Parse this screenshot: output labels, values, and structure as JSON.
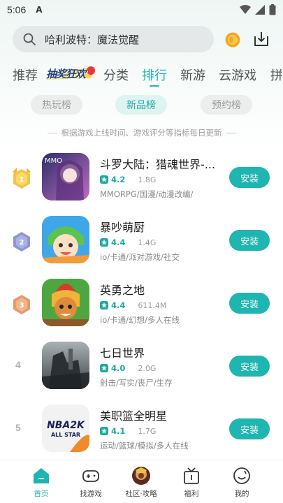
{
  "status_bar": {
    "time": "5:06",
    "indicator": "A"
  },
  "search": {
    "text": "哈利波特：魔法觉醒"
  },
  "tabs": [
    {
      "label": "推荐"
    },
    {
      "label": "抽奖狂欢",
      "is_logo": true
    },
    {
      "label": "分类"
    },
    {
      "label": "排行",
      "active": true
    },
    {
      "label": "新游"
    },
    {
      "label": "云游戏"
    },
    {
      "label": "拼"
    }
  ],
  "chips": [
    {
      "label": "热玩榜"
    },
    {
      "label": "新品榜",
      "active": true
    },
    {
      "label": "预约榜"
    }
  ],
  "subtitle": "根据游戏上线时间、游戏评分等指标每日更新",
  "games": [
    {
      "rank": "1",
      "title": "斗罗大陆：猎魂世界-...",
      "score": "4.2",
      "size": "1.8G",
      "tags": "MMORPG/国漫/动漫改编/",
      "install": "安装",
      "icon_text": "MMO"
    },
    {
      "rank": "2",
      "title": "暴吵萌厨",
      "score": "4.4",
      "size": "1.4G",
      "tags": "io/卡通/派对游戏/社交",
      "install": "安装"
    },
    {
      "rank": "3",
      "title": "英勇之地",
      "score": "4.4",
      "size": "611.4M",
      "tags": "io/卡通/幻想/多人在线",
      "install": "安装"
    },
    {
      "rank": "4",
      "title": "七日世界",
      "score": "4.0",
      "size": "2.0G",
      "tags": "射击/写实/丧尸/生存",
      "install": "安装"
    },
    {
      "rank": "5",
      "title": "美职篮全明星",
      "score": "4.1",
      "size": "1.7G",
      "tags": "运动/篮球/模拟/多人在线",
      "install": "安装",
      "icon_text": "NBA2K",
      "icon_subtext": "ALL STAR"
    }
  ],
  "bottom_nav": [
    {
      "label": "首页",
      "active": true
    },
    {
      "label": "找游戏"
    },
    {
      "label": "社区·攻略"
    },
    {
      "label": "福利"
    },
    {
      "label": "我的"
    }
  ],
  "colors": {
    "accent": "#1fb5b0",
    "score": "#1fa8a3"
  }
}
